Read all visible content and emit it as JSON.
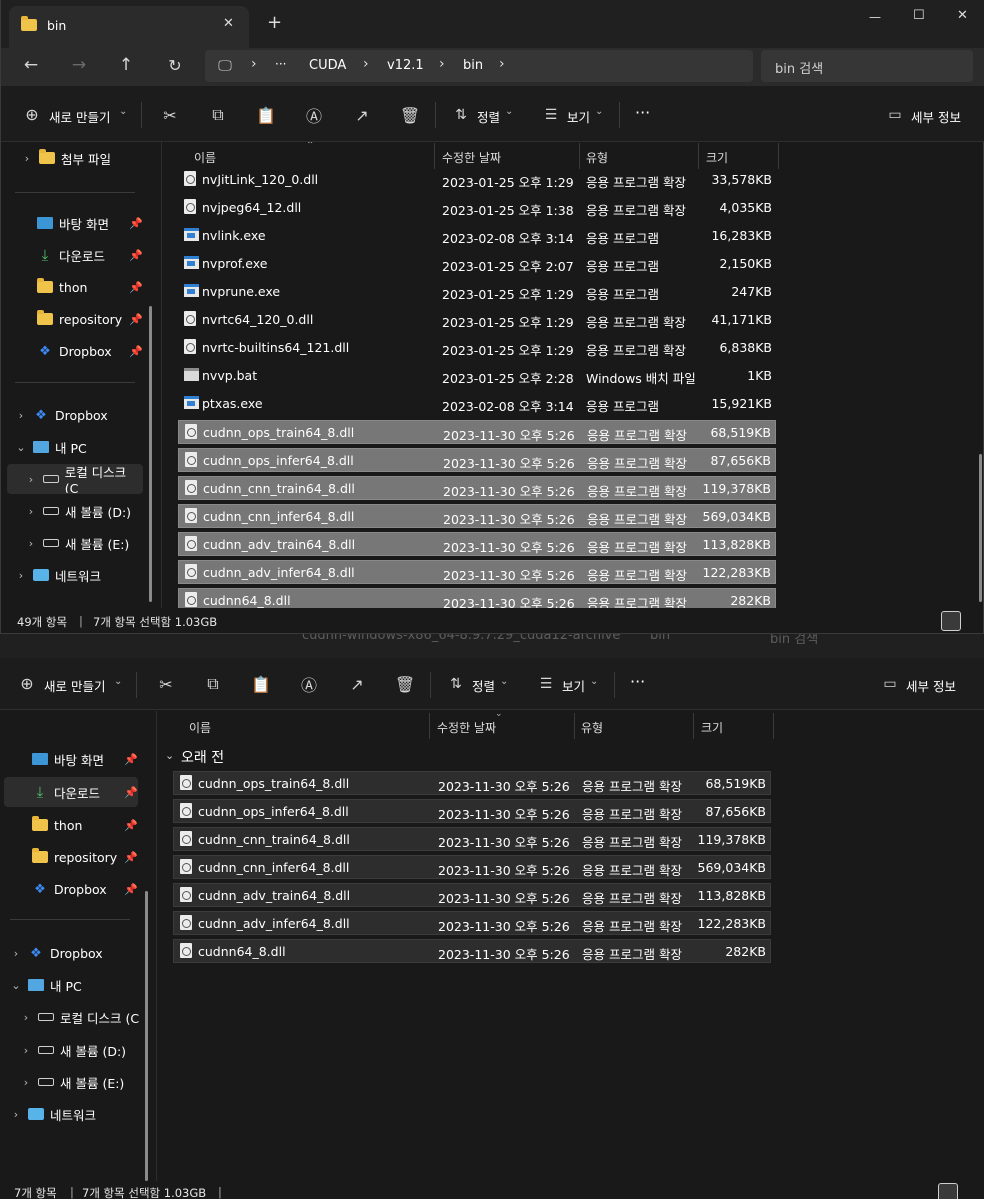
{
  "colors": {
    "selection_front": "#777777",
    "selection_back": "#2d2d2d",
    "accent_folder": "#f0c44a"
  },
  "front": {
    "tab": {
      "title": "bin",
      "close": "✕",
      "new_tab": "+"
    },
    "window_controls": {
      "minimize": "—",
      "maximize": "☐",
      "close": "✕"
    },
    "breadcrumb": {
      "ellipsis": "···",
      "items": [
        "CUDA",
        "v12.1",
        "bin"
      ]
    },
    "search_placeholder": "bin 검색",
    "toolbar": {
      "new_label": "새로 만들기",
      "sort_label": "정렬",
      "view_label": "보기",
      "more": "···",
      "details_label": "세부 정보"
    },
    "sidebar": {
      "top_item": "첨부 파일",
      "quick": [
        "바탕 화면",
        "다운로드",
        "thon",
        "repository",
        "Dropbox"
      ],
      "tree": [
        "Dropbox",
        "내 PC",
        "로컬 디스크 (C",
        "새 볼륨 (D:)",
        "새 볼륨 (E:)",
        "네트워크"
      ]
    },
    "columns": {
      "name": "이름",
      "date": "수정한 날짜",
      "type": "유형",
      "size": "크기"
    },
    "files": [
      {
        "name": "nvJitLink_120_0.dll",
        "date": "2023-01-25 오후 1:29",
        "type": "응용 프로그램 확장",
        "size": "33,578KB",
        "icon": "dll-icon"
      },
      {
        "name": "nvjpeg64_12.dll",
        "date": "2023-01-25 오후 1:38",
        "type": "응용 프로그램 확장",
        "size": "4,035KB",
        "icon": "dll-icon"
      },
      {
        "name": "nvlink.exe",
        "date": "2023-02-08 오후 3:14",
        "type": "응용 프로그램",
        "size": "16,283KB",
        "icon": "exe-icon"
      },
      {
        "name": "nvprof.exe",
        "date": "2023-01-25 오후 2:07",
        "type": "응용 프로그램",
        "size": "2,150KB",
        "icon": "exe-icon"
      },
      {
        "name": "nvprune.exe",
        "date": "2023-01-25 오후 1:29",
        "type": "응용 프로그램",
        "size": "247KB",
        "icon": "exe-icon"
      },
      {
        "name": "nvrtc64_120_0.dll",
        "date": "2023-01-25 오후 1:29",
        "type": "응용 프로그램 확장",
        "size": "41,171KB",
        "icon": "dll-icon"
      },
      {
        "name": "nvrtc-builtins64_121.dll",
        "date": "2023-01-25 오후 1:29",
        "type": "응용 프로그램 확장",
        "size": "6,838KB",
        "icon": "dll-icon"
      },
      {
        "name": "nvvp.bat",
        "date": "2023-01-25 오후 2:28",
        "type": "Windows 배치 파일",
        "size": "1KB",
        "icon": "bat-icon"
      },
      {
        "name": "ptxas.exe",
        "date": "2023-02-08 오후 3:14",
        "type": "응용 프로그램",
        "size": "15,921KB",
        "icon": "exe-icon"
      },
      {
        "name": "cudnn_ops_train64_8.dll",
        "date": "2023-11-30 오후 5:26",
        "type": "응용 프로그램 확장",
        "size": "68,519KB",
        "icon": "dll-icon",
        "selected": true
      },
      {
        "name": "cudnn_ops_infer64_8.dll",
        "date": "2023-11-30 오후 5:26",
        "type": "응용 프로그램 확장",
        "size": "87,656KB",
        "icon": "dll-icon",
        "selected": true
      },
      {
        "name": "cudnn_cnn_train64_8.dll",
        "date": "2023-11-30 오후 5:26",
        "type": "응용 프로그램 확장",
        "size": "119,378KB",
        "icon": "dll-icon",
        "selected": true
      },
      {
        "name": "cudnn_cnn_infer64_8.dll",
        "date": "2023-11-30 오후 5:26",
        "type": "응용 프로그램 확장",
        "size": "569,034KB",
        "icon": "dll-icon",
        "selected": true
      },
      {
        "name": "cudnn_adv_train64_8.dll",
        "date": "2023-11-30 오후 5:26",
        "type": "응용 프로그램 확장",
        "size": "113,828KB",
        "icon": "dll-icon",
        "selected": true
      },
      {
        "name": "cudnn_adv_infer64_8.dll",
        "date": "2023-11-30 오후 5:26",
        "type": "응용 프로그램 확장",
        "size": "122,283KB",
        "icon": "dll-icon",
        "selected": true
      },
      {
        "name": "cudnn64_8.dll",
        "date": "2023-11-30 오후 5:26",
        "type": "응용 프로그램 확장",
        "size": "282KB",
        "icon": "dll-icon",
        "selected": true
      }
    ],
    "status": {
      "count": "49개 항목",
      "selected": "7개 항목 선택함 1.03GB"
    }
  },
  "back": {
    "ghost_path": "cudnn-windows-x86_64-8.9.7.29_cuda12-archive",
    "ghost_bin": "bin",
    "ghost_search": "bin 검색",
    "toolbar": {
      "new_label": "새로 만들기",
      "sort_label": "정렬",
      "view_label": "보기",
      "more": "···",
      "details_label": "세부 정보"
    },
    "sidebar": {
      "quick": [
        "바탕 화면",
        "다운로드",
        "thon",
        "repository",
        "Dropbox"
      ],
      "tree": [
        "Dropbox",
        "내 PC",
        "로컬 디스크 (C",
        "새 볼륨 (D:)",
        "새 볼륨 (E:)",
        "네트워크"
      ]
    },
    "columns": {
      "name": "이름",
      "date": "수정한 날짜",
      "type": "유형",
      "size": "크기"
    },
    "group_label": "오래 전",
    "files": [
      {
        "name": "cudnn_ops_train64_8.dll",
        "date": "2023-11-30 오후 5:26",
        "type": "응용 프로그램 확장",
        "size": "68,519KB"
      },
      {
        "name": "cudnn_ops_infer64_8.dll",
        "date": "2023-11-30 오후 5:26",
        "type": "응용 프로그램 확장",
        "size": "87,656KB"
      },
      {
        "name": "cudnn_cnn_train64_8.dll",
        "date": "2023-11-30 오후 5:26",
        "type": "응용 프로그램 확장",
        "size": "119,378KB"
      },
      {
        "name": "cudnn_cnn_infer64_8.dll",
        "date": "2023-11-30 오후 5:26",
        "type": "응용 프로그램 확장",
        "size": "569,034KB"
      },
      {
        "name": "cudnn_adv_train64_8.dll",
        "date": "2023-11-30 오후 5:26",
        "type": "응용 프로그램 확장",
        "size": "113,828KB"
      },
      {
        "name": "cudnn_adv_infer64_8.dll",
        "date": "2023-11-30 오후 5:26",
        "type": "응용 프로그램 확장",
        "size": "122,283KB"
      },
      {
        "name": "cudnn64_8.dll",
        "date": "2023-11-30 오후 5:26",
        "type": "응용 프로그램 확장",
        "size": "282KB"
      }
    ],
    "status": {
      "count": "7개 항목",
      "selected": "7개 항목 선택함 1.03GB"
    }
  }
}
